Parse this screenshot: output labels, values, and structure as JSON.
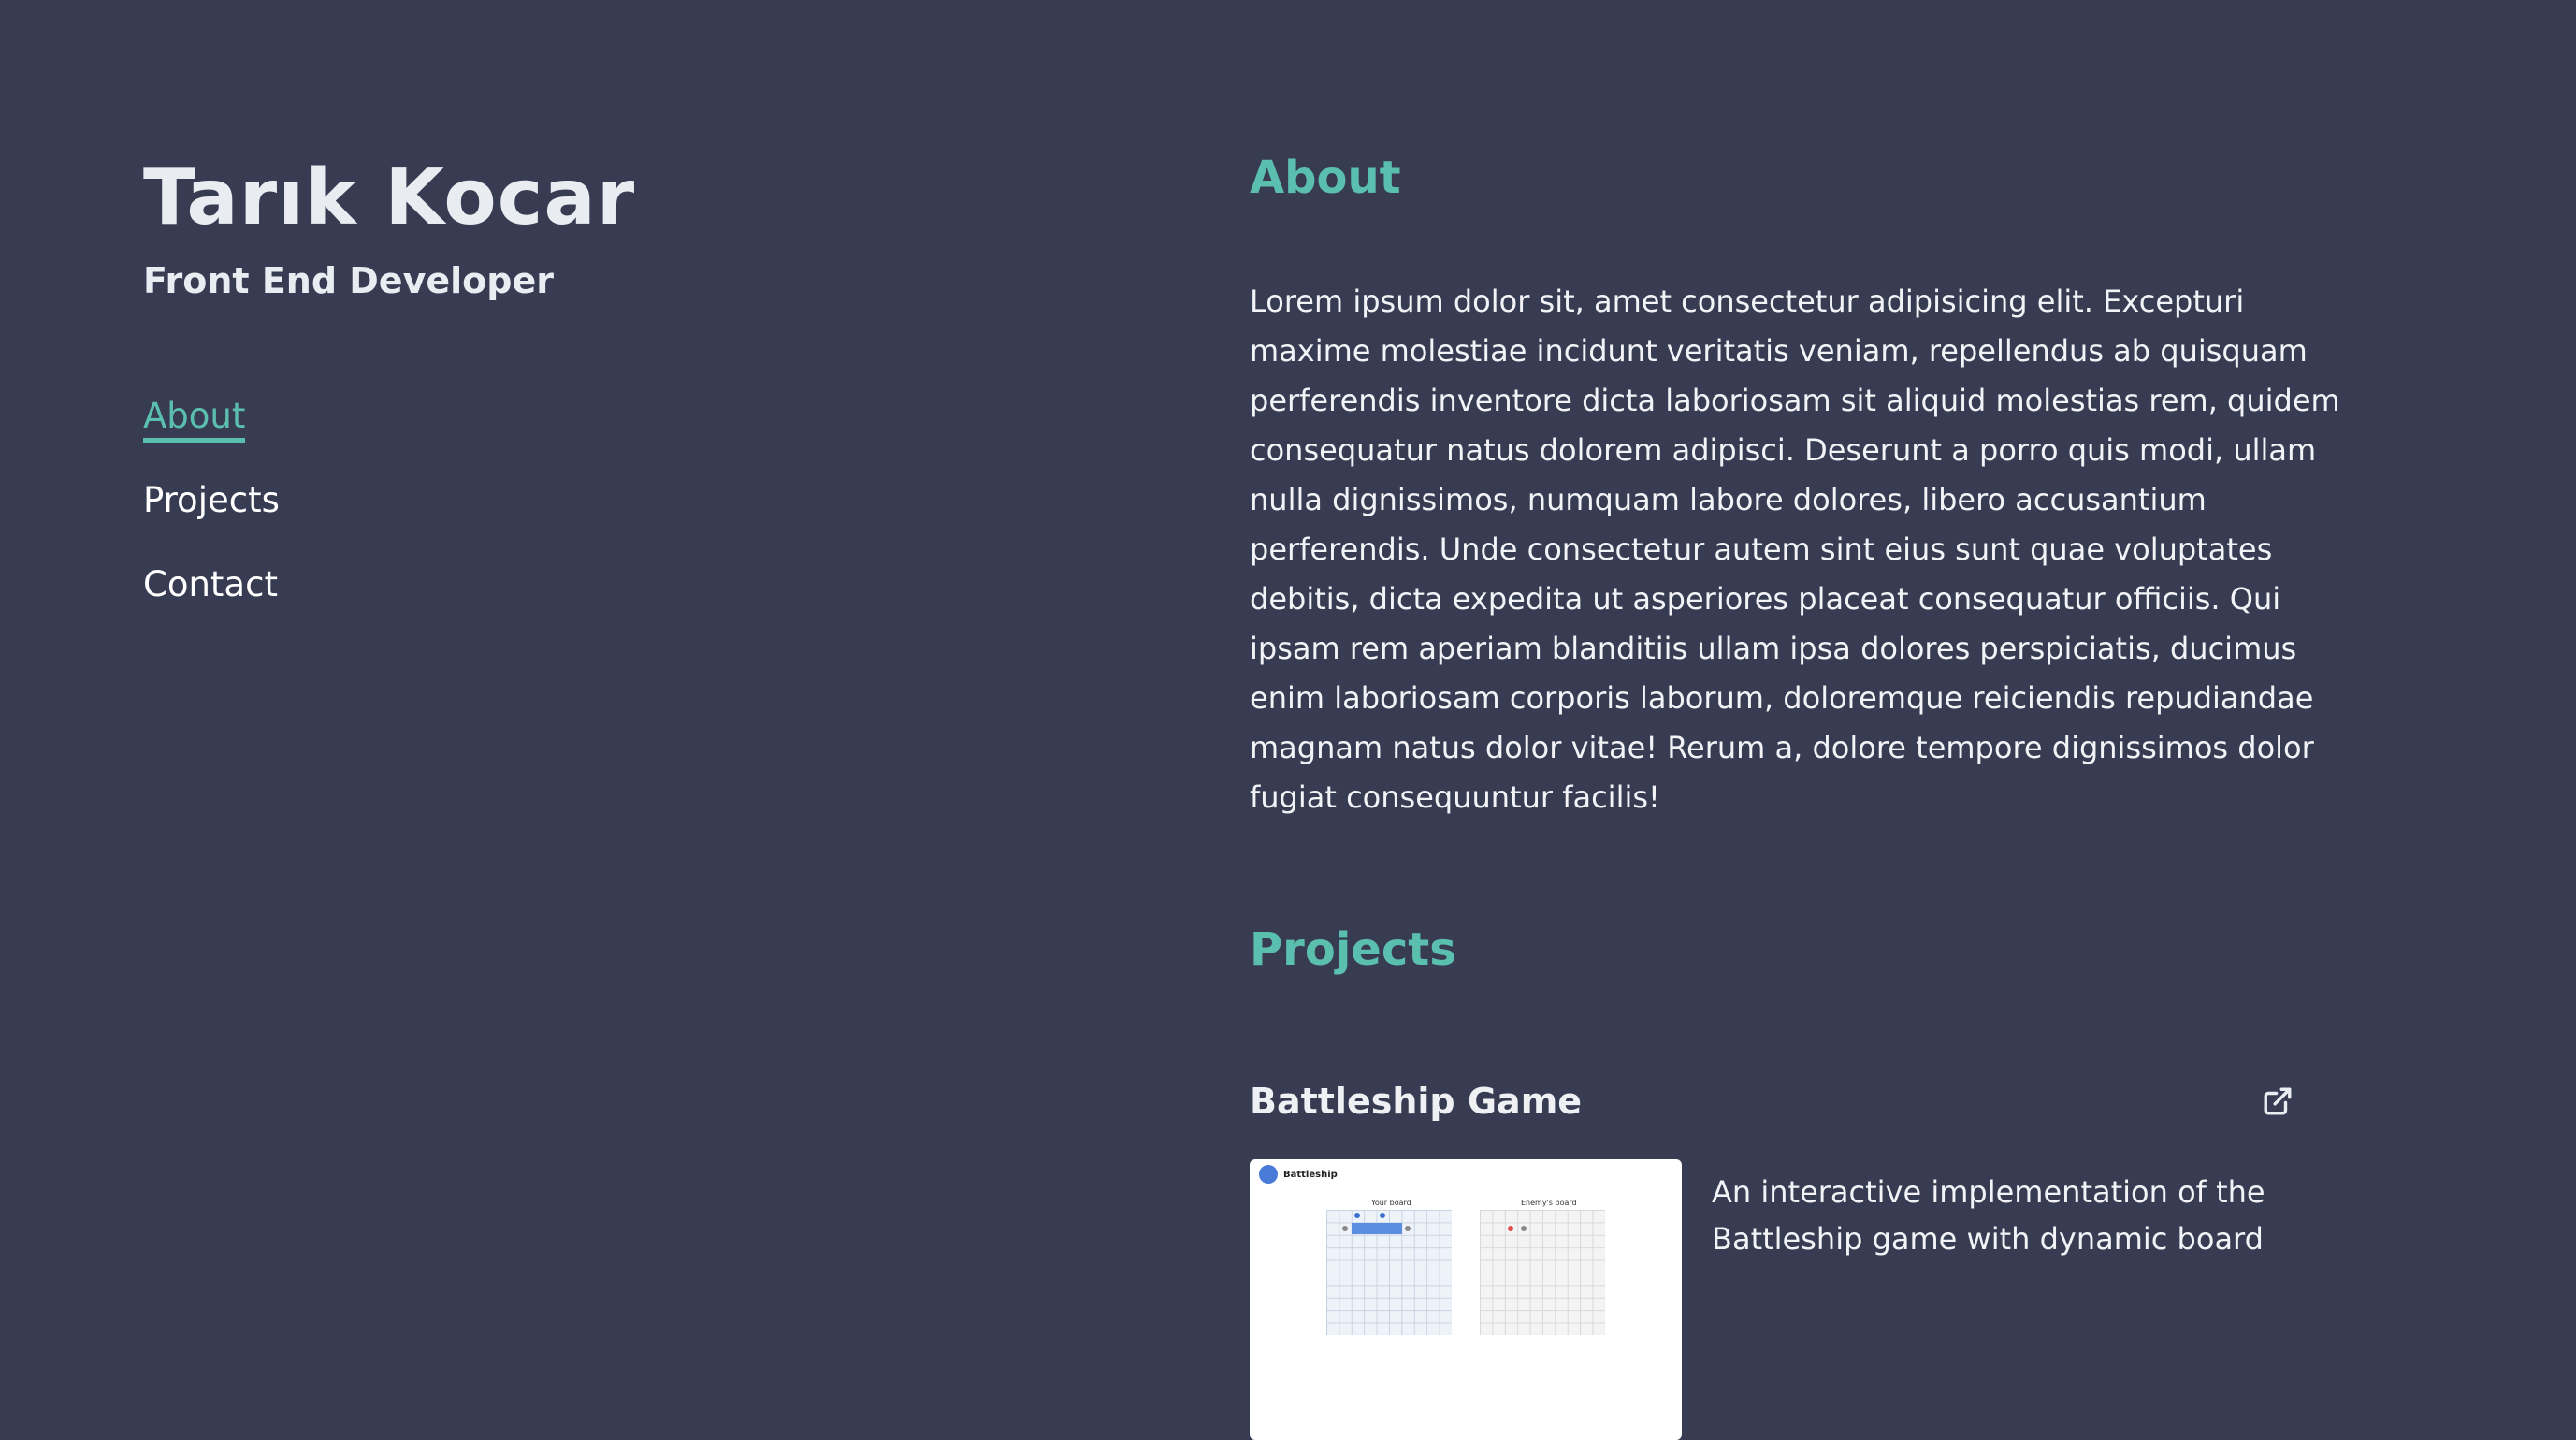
{
  "profile": {
    "name": "Tarık Kocar",
    "role": "Front End Developer"
  },
  "nav": {
    "items": [
      {
        "label": "About",
        "active": true
      },
      {
        "label": "Projects",
        "active": false
      },
      {
        "label": "Contact",
        "active": false
      }
    ]
  },
  "about": {
    "title": "About",
    "text": "Lorem ipsum dolor sit, amet consectetur adipisicing elit. Excepturi maxime molestiae incidunt veritatis veniam, repellendus ab quisquam perferendis inventore dicta laboriosam sit aliquid molestias rem, quidem consequatur natus dolorem adipisci. Deserunt a porro quis modi, ullam nulla dignissimos, numquam labore dolores, libero accusantium perferendis. Unde consectetur autem sint eius sunt quae voluptates debitis, dicta expedita ut asperiores placeat consequatur officiis. Qui ipsam rem aperiam blanditiis ullam ipsa dolores perspiciatis, ducimus enim laboriosam corporis laborum, doloremque reiciendis repudiandae magnam natus dolor vitae! Rerum a, dolore tempore dignissimos dolor fugiat consequuntur facilis!"
  },
  "projects": {
    "title": "Projects",
    "items": [
      {
        "title": "Battleship Game",
        "description": "An interactive implementation of the Battleship game with dynamic board",
        "thumbnail": {
          "app_title": "Battleship",
          "your_board_label": "Your board",
          "enemy_board_label": "Enemy's board"
        },
        "link_icon": "external-link-icon"
      }
    ]
  },
  "colors": {
    "background": "#383c52",
    "accent": "#5bbfaf",
    "text": "#e9ecf1"
  }
}
